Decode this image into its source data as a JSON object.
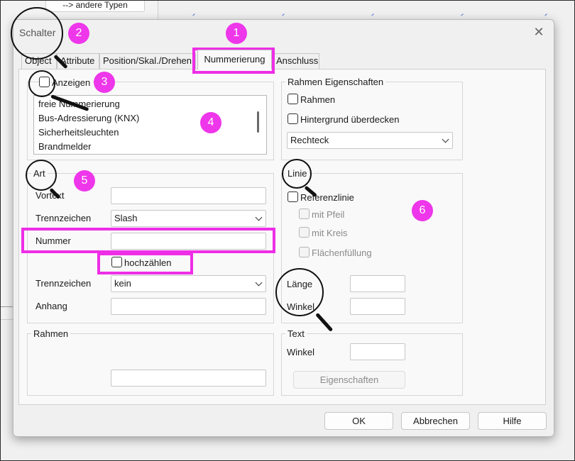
{
  "background": {
    "button_label": "--> andere Typen"
  },
  "dialog": {
    "title": "Schalter",
    "close_glyph": "✕",
    "tabs": [
      "Object",
      "Attribute",
      "Position/Skal./Drehen",
      "Nummerierung",
      "Anschluss"
    ],
    "active_tab": "Nummerierung"
  },
  "display": {
    "checkbox_label": "Anzeigen",
    "list_items": [
      "freie Nummerierung",
      "Bus-Adressierung (KNX)",
      "Sicherheitsleuchten",
      "Brandmelder"
    ]
  },
  "art": {
    "legend": "Art",
    "vortext_label": "Vortext",
    "vortext_value": "",
    "separator1_label": "Trennzeichen",
    "separator1_value": "Slash",
    "number_label": "Nummer",
    "number_value": "",
    "increment_label": "hochzählen",
    "separator2_label": "Trennzeichen",
    "separator2_value": "kein",
    "suffix_label": "Anhang",
    "suffix_value": ""
  },
  "rahmen_left": {
    "legend": "Rahmen",
    "value": ""
  },
  "frame_props": {
    "legend": "Rahmen Eigenschaften",
    "frame_label": "Rahmen",
    "cover_bg_label": "Hintergrund überdecken",
    "shape_value": "Rechteck"
  },
  "line": {
    "legend": "Linie",
    "ref_line_label": "Referenzlinie",
    "arrow_label": "mit Pfeil",
    "circle_label": "mit Kreis",
    "fill_label": "Flächenfüllung",
    "length_label": "Länge",
    "length_value": "",
    "angle_label": "Winkel",
    "angle_value": ""
  },
  "text": {
    "legend": "Text",
    "angle_label": "Winkel",
    "angle_value": "",
    "properties_button": "Eigenschaften"
  },
  "footer": {
    "ok": "OK",
    "cancel": "Abbrechen",
    "help": "Hilfe"
  },
  "annotations": [
    "1",
    "2",
    "3",
    "4",
    "5",
    "6"
  ],
  "colors": {
    "highlight": "#ee2ee6",
    "badge": "#ee36ea"
  }
}
